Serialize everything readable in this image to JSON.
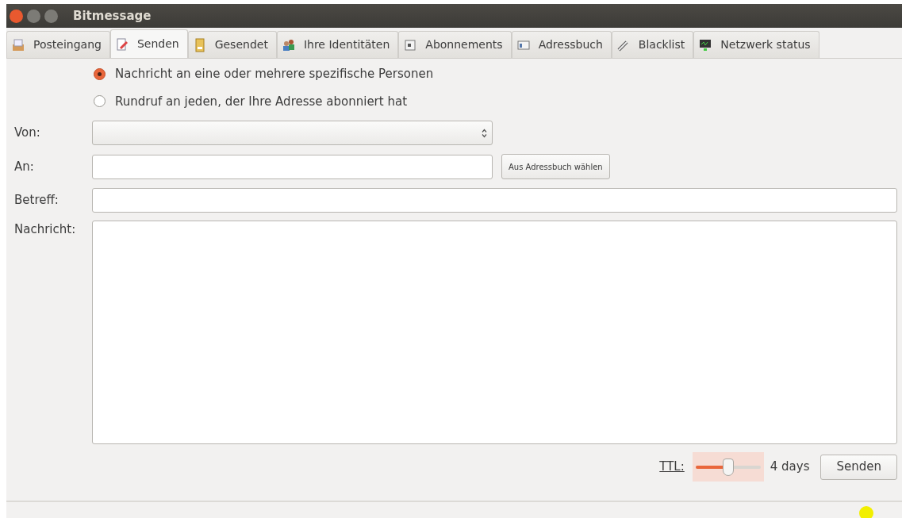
{
  "window": {
    "title": "Bitmessage"
  },
  "tabs": [
    {
      "label": "Posteingang",
      "selected": false
    },
    {
      "label": "Senden",
      "selected": true
    },
    {
      "label": "Gesendet",
      "selected": false
    },
    {
      "label": "Ihre Identitäten",
      "selected": false
    },
    {
      "label": "Abonnements",
      "selected": false
    },
    {
      "label": "Adressbuch",
      "selected": false
    },
    {
      "label": "Blacklist",
      "selected": false
    },
    {
      "label": "Netzwerk status",
      "selected": false
    }
  ],
  "recipient_mode": [
    {
      "label": "Nachricht an eine oder mehrere spezifische Personen",
      "selected": true
    },
    {
      "label": "Rundruf an jeden, der Ihre Adresse abonniert hat",
      "selected": false
    }
  ],
  "form": {
    "from_label": "Von:",
    "to_label": "An:",
    "address_book_button": "Aus Adressbuch wählen",
    "subject_label": "Betreff:",
    "message_label": "Nachricht:"
  },
  "ttl": {
    "label": "TTL:",
    "level": 0.5,
    "reading": "4 days"
  },
  "send_button": "Senden"
}
